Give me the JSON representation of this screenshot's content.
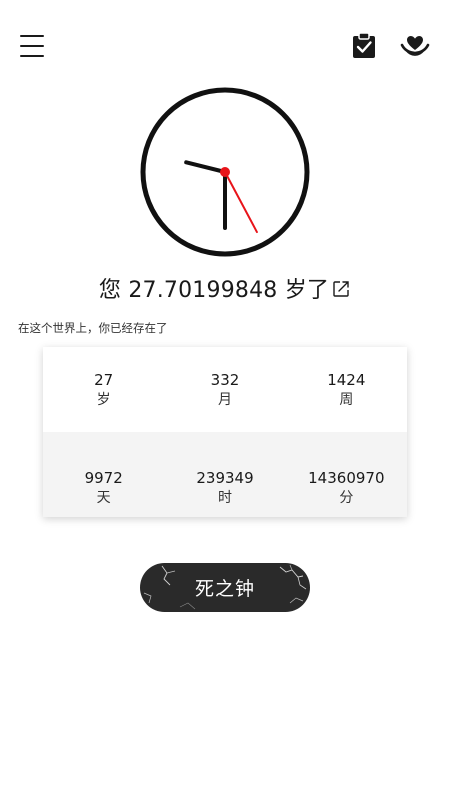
{
  "header": {
    "menu_icon": "hamburger-menu-icon",
    "clipboard_icon": "clipboard-check-icon",
    "heart_icon": "heart-in-hands-icon"
  },
  "clock": {
    "hour": 9,
    "minute": 30,
    "second": 27,
    "hand_color": "#111111",
    "second_hand_color": "#e8141a"
  },
  "age": {
    "prefix": "您",
    "value": "27.70199848",
    "suffix": "岁了",
    "edit_icon": "external-edit-icon"
  },
  "subtitle": "在这个世界上，你已经存在了",
  "stats": [
    [
      {
        "value": "27",
        "unit": "岁"
      },
      {
        "value": "332",
        "unit": "月"
      },
      {
        "value": "1424",
        "unit": "周"
      }
    ],
    [
      {
        "value": "9972",
        "unit": "天"
      },
      {
        "value": "239349",
        "unit": "时"
      },
      {
        "value": "14360970",
        "unit": "分"
      }
    ]
  ],
  "death_button": {
    "label": "死之钟",
    "color": "#2a2a2a"
  }
}
